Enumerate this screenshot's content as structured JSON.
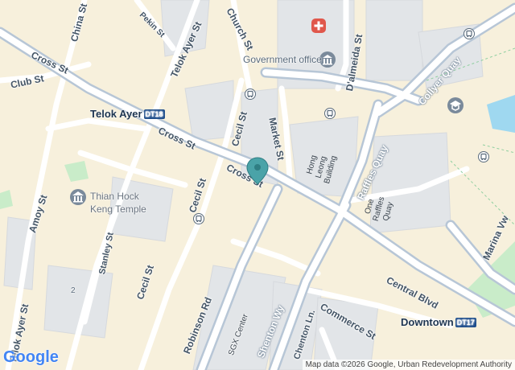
{
  "map": {
    "roads": {
      "cross_st_nw": "Cross St",
      "cross_st_mid": "Cross St",
      "cross_st_center": "Cross St",
      "club_st": "Club St",
      "china_st": "China St",
      "pekin_st": "Pekin St",
      "telok_ayer_st_north": "Telok Ayer St",
      "church_st": "Church St",
      "dalmeida_st": "D'almeida St",
      "cecil_st_north": "Cecil St",
      "market_st": "Market St",
      "cecil_st_mid": "Cecil St",
      "cecil_st_south": "Cecil St",
      "amoy_st": "Amoy St",
      "stanley_st": "Stanley St",
      "telok_ayer_st_south": "Telok Ayer St",
      "robinson_rd": "Robinson Rd",
      "shenton_wy": "Shenton Wy",
      "raffles_quay": "Raffles Quay",
      "collyer_quay": "Collyer Quay",
      "central_blvd": "Central Blvd",
      "commerce_st": "Commerce St",
      "chenton_ln": "Chenton Ln.",
      "marina_vw": "Marina Vw"
    },
    "stations": [
      {
        "name": "Telok Ayer",
        "code": "DT18"
      },
      {
        "name": "Downtown",
        "code": "DT17"
      }
    ],
    "pois": {
      "government_office": "Government office",
      "thian_hock_keng": "Thian Hock\nKeng Temple"
    },
    "buildings": {
      "hong_leong": "Hong\nLeong\nBuilding",
      "one_raffles_quay": "One\nRaffles\nQuay",
      "sgx_center": "SGX Center"
    },
    "house_number": "2",
    "logo": "Google",
    "attribution": "Map data ©2026 Google, Urban Redevelopment Authority",
    "colors": {
      "land": "#f7f0dc",
      "road": "#ffffff",
      "major_road": "#b7c6d6",
      "building": "#e2e5e8",
      "water": "#9fd8f0",
      "park": "#c9ecc9",
      "pin": "#4aa3a8",
      "station_badge": "#1f4e8c",
      "hospital": "#e0574b"
    },
    "icons": [
      "hospital-icon",
      "government-icon",
      "temple-icon",
      "university-icon",
      "bus-icon",
      "location-pin-icon"
    ]
  }
}
